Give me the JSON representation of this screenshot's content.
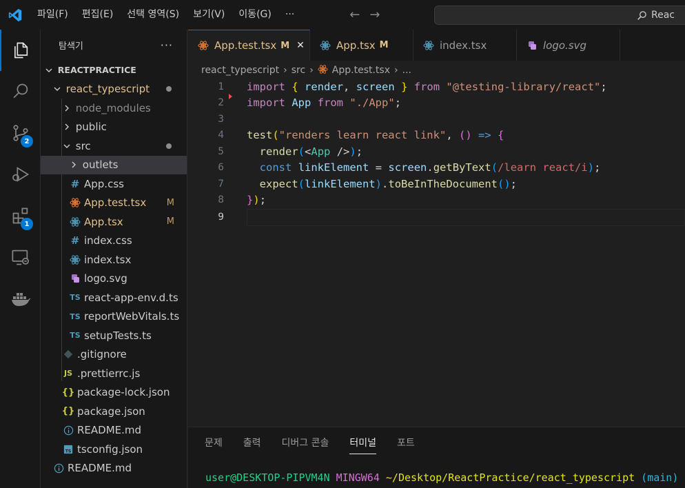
{
  "titlebar": {
    "menu": [
      "파일(F)",
      "편집(E)",
      "선택 영역(S)",
      "보기(V)",
      "이동(G)",
      "···"
    ],
    "search_text": "Reac"
  },
  "activity": {
    "scm_badge": "2",
    "extensions_badge": "1"
  },
  "sidebar": {
    "title": "탐색기",
    "more": "···",
    "tree": [
      {
        "label": "REACTPRACTICE",
        "depth": 0,
        "kind": "folder-open",
        "bold": true
      },
      {
        "label": "react_typescript",
        "depth": 1,
        "kind": "folder-open",
        "mod": "dot"
      },
      {
        "label": "node_modules",
        "depth": 2,
        "kind": "folder",
        "ignored": true
      },
      {
        "label": "public",
        "depth": 2,
        "kind": "folder"
      },
      {
        "label": "src",
        "depth": 2,
        "kind": "folder-open",
        "mod": "dot"
      },
      {
        "label": "outlets",
        "depth": 3,
        "kind": "folder",
        "selected": true
      },
      {
        "label": "App.css",
        "depth": 3,
        "icon": "css-icon"
      },
      {
        "label": "App.test.tsx",
        "depth": 3,
        "icon": "react-test-icon",
        "mod": "M"
      },
      {
        "label": "App.tsx",
        "depth": 3,
        "icon": "react-icon",
        "mod": "M"
      },
      {
        "label": "index.css",
        "depth": 3,
        "icon": "css-icon"
      },
      {
        "label": "index.tsx",
        "depth": 3,
        "icon": "react-icon"
      },
      {
        "label": "logo.svg",
        "depth": 3,
        "icon": "svg-icon"
      },
      {
        "label": "react-app-env.d.ts",
        "depth": 3,
        "icon": "ts-icon"
      },
      {
        "label": "reportWebVitals.ts",
        "depth": 3,
        "icon": "ts-icon"
      },
      {
        "label": "setupTests.ts",
        "depth": 3,
        "icon": "ts-icon"
      },
      {
        "label": ".gitignore",
        "depth": 2,
        "icon": "git-icon"
      },
      {
        "label": ".prettierrc.js",
        "depth": 2,
        "icon": "js-icon"
      },
      {
        "label": "package-lock.json",
        "depth": 2,
        "icon": "json-icon"
      },
      {
        "label": "package.json",
        "depth": 2,
        "icon": "json-icon"
      },
      {
        "label": "README.md",
        "depth": 2,
        "icon": "info-icon"
      },
      {
        "label": "tsconfig.json",
        "depth": 2,
        "icon": "tsconfig-icon"
      },
      {
        "label": "README.md",
        "depth": 1,
        "icon": "info-icon"
      }
    ]
  },
  "tabs": [
    {
      "label": "App.test.tsx",
      "mod": "M",
      "active": true,
      "icon": "react-test-icon"
    },
    {
      "label": "App.tsx",
      "mod": "M",
      "icon": "react-icon"
    },
    {
      "label": "index.tsx",
      "icon": "react-icon"
    },
    {
      "label": "logo.svg",
      "icon": "svg-icon",
      "italic": true
    }
  ],
  "breadcrumb": [
    "react_typescript",
    "src",
    "App.test.tsx",
    "..."
  ],
  "editor": {
    "line_numbers": [
      "1",
      "2",
      "3",
      "4",
      "5",
      "6",
      "7",
      "8",
      "9"
    ],
    "code": {
      "l1": {
        "import": "import",
        "open": "{",
        "render": "render",
        "comma": ",",
        "screen": "screen",
        "close": "}",
        "from": "from",
        "module": "\"@testing-library/react\"",
        "semi": ";"
      },
      "l2": {
        "import": "import",
        "app": "App",
        "from": "from",
        "module": "\"./App\"",
        "semi": ";"
      },
      "l4": {
        "test": "test",
        "open": "(",
        "name": "\"renders learn react link\"",
        "comma": ",",
        "paren": "()",
        "arrow": "=>",
        "brace": "{"
      },
      "l5": {
        "render": "render",
        "open": "(",
        "lt": "<",
        "app": "App",
        "selfclose": "/>",
        "close": ")",
        "semi": ";"
      },
      "l6": {
        "const": "const",
        "var": "linkElement",
        "eq": "=",
        "screen": "screen",
        "dot": ".",
        "fn": "getByText",
        "open": "(",
        "regex": "/learn react/i",
        "close": ")",
        "semi": ";"
      },
      "l7": {
        "expect": "expect",
        "open": "(",
        "var": "linkElement",
        "close": ")",
        "dot": ".",
        "fn": "toBeInTheDocument",
        "call": "()",
        "semi": ";"
      },
      "l8": {
        "brace": "}",
        "paren": ")",
        "semi": ";"
      }
    }
  },
  "panel": {
    "tabs": [
      "문제",
      "출력",
      "디버그 콘솔",
      "터미널",
      "포트"
    ],
    "active_tab": "터미널",
    "terminal": {
      "user": "user@DESKTOP-PIPVM4N",
      "shell": "MINGW64",
      "path": "~/Desktop/ReactPractice/react_typescript",
      "branch": "(main)"
    }
  }
}
